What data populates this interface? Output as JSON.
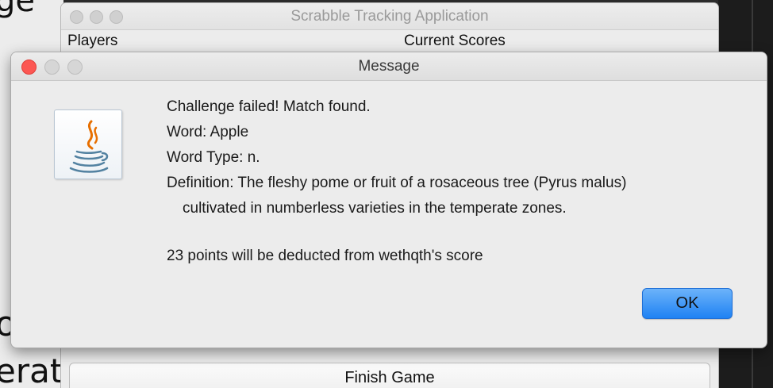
{
  "background": {
    "left_window": {
      "top_fragment": "ge",
      "mid_fragment": "o",
      "bottom_fragment": "erat"
    }
  },
  "app_window": {
    "title": "Scrabble Tracking Application",
    "headers": {
      "players": "Players",
      "current_scores": "Current Scores"
    },
    "finish_button_label": "Finish Game"
  },
  "dialog": {
    "title": "Message",
    "icon": "java-coffee-cup-icon",
    "lines": [
      "Challenge failed! Match found.",
      "Word: Apple",
      "Word Type: n.",
      "Definition: The fleshy pome or fruit of a rosaceous tree (Pyrus malus)",
      "cultivated in numberless varieties in the temperate zones.",
      "23 points will be deducted from wethqth's score"
    ],
    "ok_button_label": "OK"
  },
  "colors": {
    "close_button": "#fc5753",
    "ok_button": "#1f82f3",
    "java_orange": "#e76f00",
    "java_blue": "#5382a1"
  }
}
